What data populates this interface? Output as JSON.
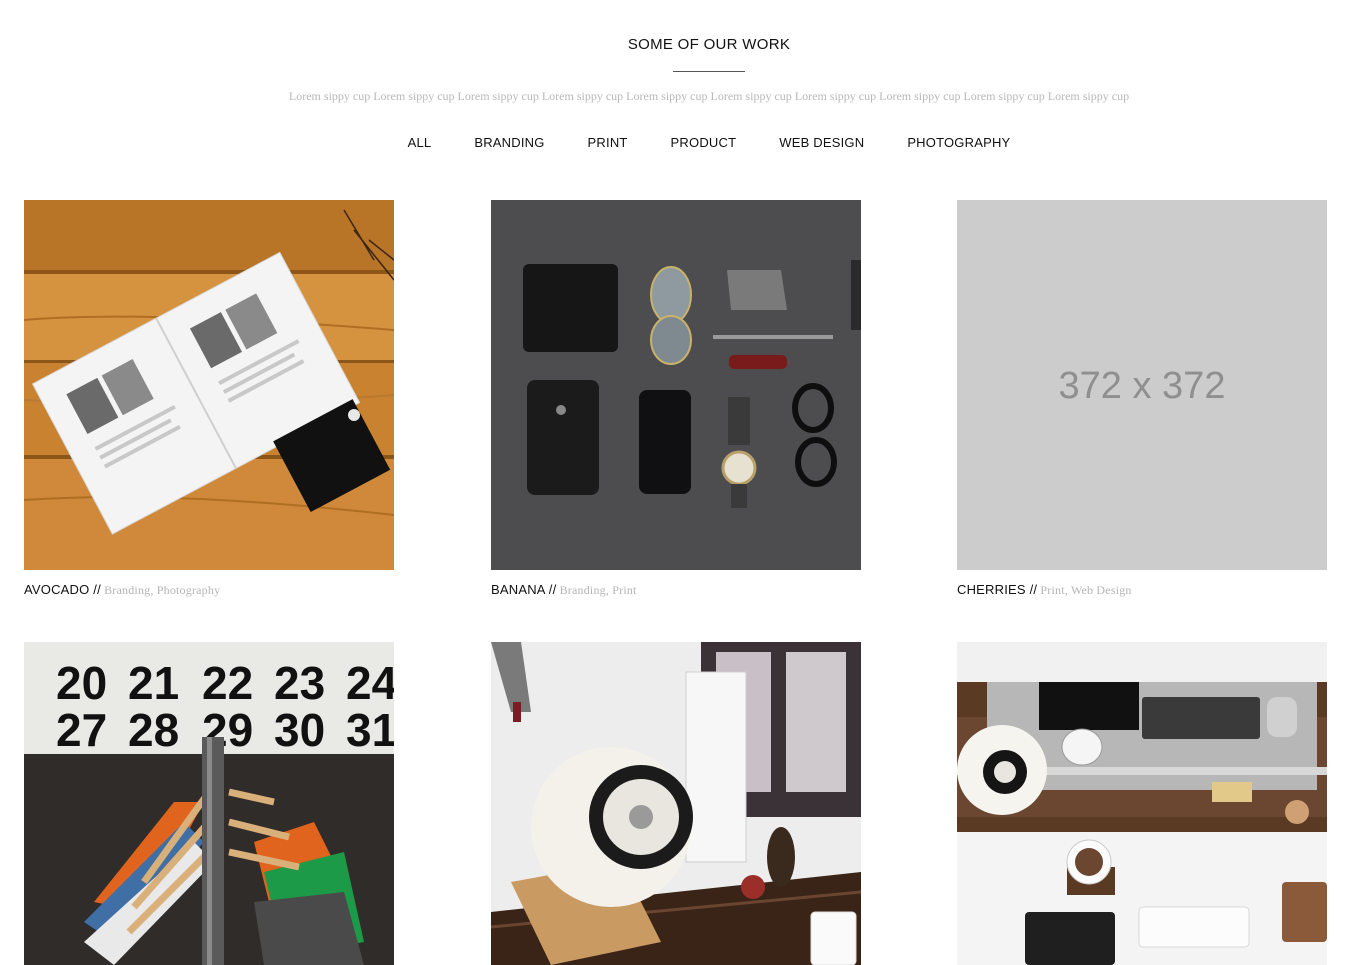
{
  "header": {
    "title": "SOME OF OUR WORK",
    "subtitle": "Lorem sippy cup Lorem sippy cup Lorem sippy cup Lorem sippy cup Lorem sippy cup Lorem sippy cup Lorem sippy cup Lorem sippy cup Lorem sippy cup Lorem sippy cup"
  },
  "filters": [
    "ALL",
    "BRANDING",
    "PRINT",
    "PRODUCT",
    "WEB DESIGN",
    "PHOTOGRAPHY"
  ],
  "portfolio": [
    {
      "name": "AVOCADO",
      "separator": " //",
      "categories": " Branding, Photography"
    },
    {
      "name": "BANANA",
      "separator": " //",
      "categories": " Branding, Print"
    },
    {
      "name": "CHERRIES",
      "separator": " //",
      "categories": " Print, Web Design",
      "placeholder": "372 x 372"
    }
  ],
  "calendar_numbers": [
    "20",
    "21",
    "22",
    "23",
    "24",
    "27",
    "28",
    "29",
    "30",
    "31"
  ],
  "colors": {
    "placeholder_bg": "#cccccc",
    "muted_text": "#b4b4b4",
    "accent": "#111111"
  }
}
